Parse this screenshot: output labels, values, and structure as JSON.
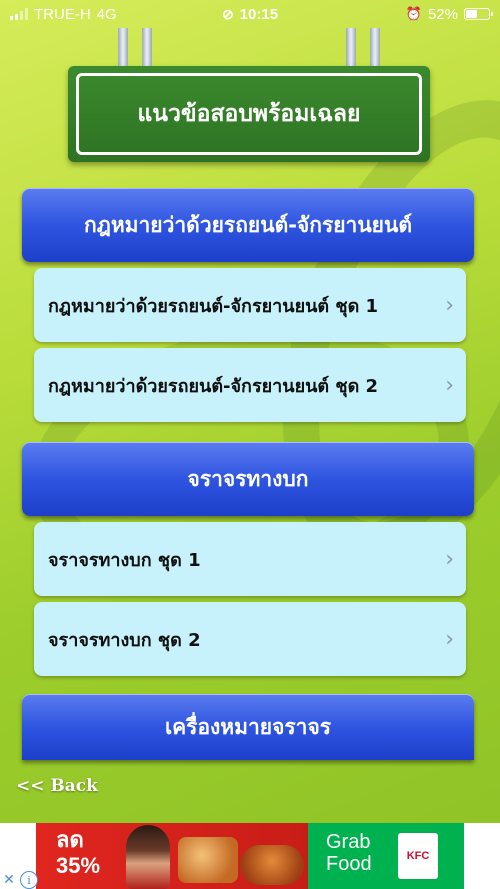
{
  "status_bar": {
    "carrier": "TRUE-H",
    "network": "4G",
    "time": "10:15",
    "battery": "52%",
    "battery_level": 0.52
  },
  "header": {
    "title": "แนวข้อสอบพร้อมเฉลย"
  },
  "sections": [
    {
      "title": "กฎหมายว่าด้วยรถยนต์-จักรยานยนต์",
      "items": [
        {
          "label": "กฎหมายว่าด้วยรถยนต์-จักรยานยนต์ ชุด 1"
        },
        {
          "label": "กฎหมายว่าด้วยรถยนต์-จักรยานยนต์ ชุด 2"
        }
      ]
    },
    {
      "title": "จราจรทางบก",
      "items": [
        {
          "label": "จราจรทางบก ชุด 1"
        },
        {
          "label": "จราจรทางบก ชุด 2"
        }
      ]
    },
    {
      "title": "เครื่องหมายจราจร",
      "items": []
    }
  ],
  "chevron": "›",
  "back_label": "<< Back",
  "ad": {
    "discount_line1": "ลด",
    "discount_line2": "35%",
    "brand_line1": "Grab",
    "brand_line2": "Food",
    "kfc": "KFC",
    "close": "✕",
    "info": "i"
  },
  "colors": {
    "section_blue": "#2f55e0",
    "item_cyan": "#c8f2fb",
    "sign_green": "#2d7323",
    "background_green": "#b9dc3a"
  }
}
